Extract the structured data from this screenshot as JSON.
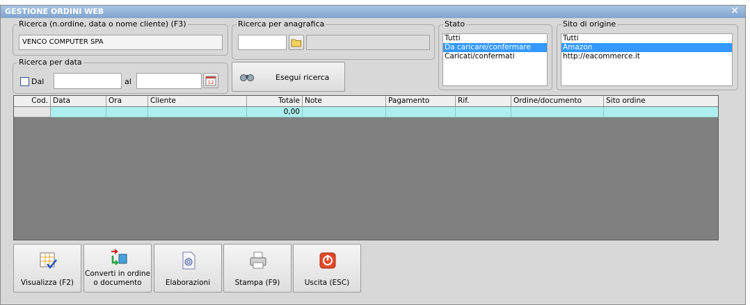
{
  "window": {
    "title": "GESTIONE ORDINI WEB",
    "close_glyph": "✕"
  },
  "search": {
    "label": "Ricerca (n.ordine, data o nome cliente) (F3)",
    "value": "VENCO COMPUTER SPA"
  },
  "anagrafica": {
    "label": "Ricerca per anagrafica",
    "code_value": "",
    "name_value": "",
    "folder_icon": "folder-icon"
  },
  "date_search": {
    "label": "Ricerca per data",
    "dal_label": "Dal",
    "dal_checked": false,
    "al_label": "al",
    "from_value": "",
    "to_value": "",
    "calendar_icon": "calendar-icon",
    "calendar_day": "12"
  },
  "search_button": {
    "label": "Esegui ricerca",
    "icon": "binoculars-icon"
  },
  "stato": {
    "label": "Stato",
    "items": [
      "Tutti",
      "Da caricare/confermare",
      "Caricati/confermati"
    ],
    "selected": "Da caricare/confermare"
  },
  "sito": {
    "label": "Sito di origine",
    "items": [
      "Tutti",
      "Amazon",
      "http://eacommerce.it"
    ],
    "selected": "Amazon"
  },
  "table": {
    "columns": [
      "Cod.",
      "Data",
      "Ora",
      "Cliente",
      "Totale",
      "Note",
      "Pagamento",
      "Rif.",
      "Ordine/documento",
      "Sito ordine"
    ],
    "rows": [
      [
        "",
        "",
        "",
        "",
        "0,00",
        "",
        "",
        "",
        "",
        ""
      ]
    ]
  },
  "toolbar": {
    "buttons": [
      {
        "name": "visualizza-button",
        "icon": "grid-check-icon",
        "label": "Visualizza (F2)"
      },
      {
        "name": "converti-button",
        "icon": "convert-arrows-icon",
        "label": "Converti in ordine\no documento"
      },
      {
        "name": "elaborazioni-button",
        "icon": "gear-document-icon",
        "label": "Elaborazioni"
      },
      {
        "name": "stampa-button",
        "icon": "printer-icon",
        "label": "Stampa (F9)"
      },
      {
        "name": "uscita-button",
        "icon": "power-icon",
        "label": "Uscita (ESC)"
      }
    ]
  },
  "colors": {
    "title_bar": "#7fa4cf",
    "selection": "#3399ff",
    "row_highlight": "#aeeff0",
    "grid_background": "#808080"
  }
}
